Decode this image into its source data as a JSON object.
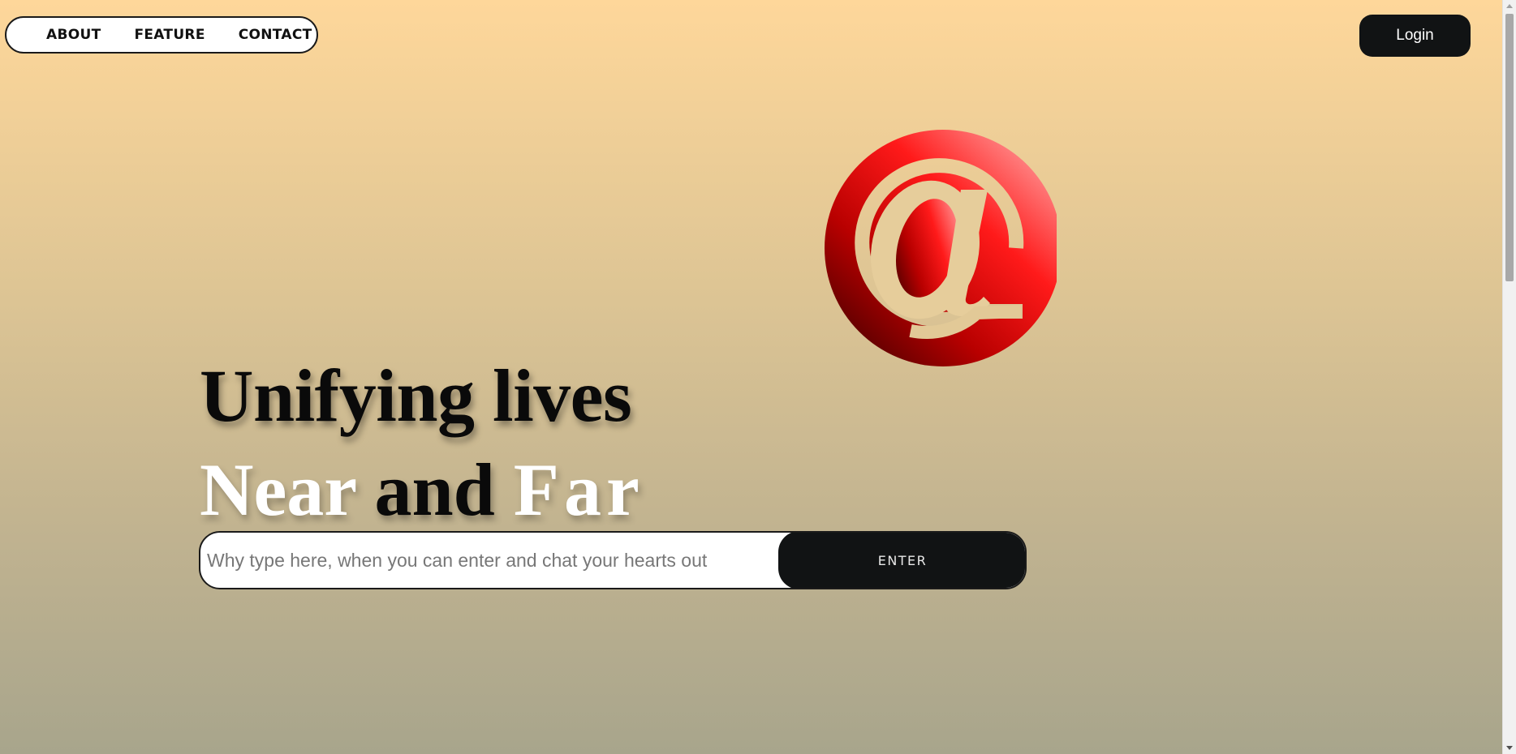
{
  "nav": {
    "items": [
      {
        "label": "ABOUT"
      },
      {
        "label": "FEATURE"
      },
      {
        "label": "CONTACT"
      }
    ]
  },
  "header": {
    "login_label": "Login"
  },
  "logo": {
    "icon": "at-sign-icon",
    "glyph": "@",
    "colors": {
      "light": "#ff4a4a",
      "dark": "#7a0000"
    }
  },
  "hero": {
    "line1": "Unifying lives",
    "line2": {
      "word1": "Near",
      "word2": "and",
      "word3": "Far"
    }
  },
  "search": {
    "placeholder": "Why type here, when you can enter and chat your hearts out",
    "value": "",
    "button_label": "ENTER"
  },
  "colors": {
    "background_top": "#fed79a",
    "background_bottom": "#a8a58c",
    "button_dark": "#111314"
  }
}
